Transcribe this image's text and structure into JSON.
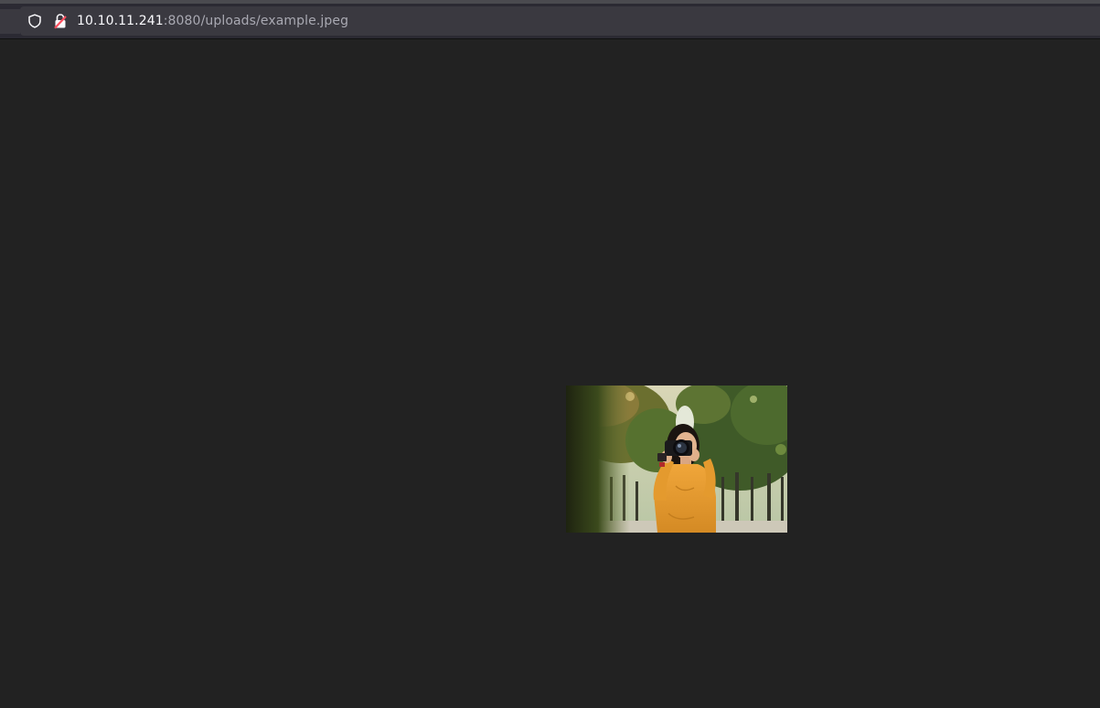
{
  "browser": {
    "address_bar": {
      "host": "10.10.11.241",
      "rest": ":8080/uploads/example.jpeg"
    },
    "icons": {
      "tracking_protection": "shield-icon",
      "connection_security": "insecure-lock-icon"
    }
  },
  "content": {
    "image": {
      "subject": "woman in orange sweater holding a camera outdoors among trees",
      "colors": {
        "sweater": "#e59a2e",
        "foliage": "#4f6b2c",
        "sky": "#e8e4cf"
      }
    }
  },
  "colors": {
    "page_background": "#222222",
    "toolbar_background": "#2b2a33",
    "urlbar_background": "#3a3940",
    "lock_warning": "#ff4f5e"
  }
}
